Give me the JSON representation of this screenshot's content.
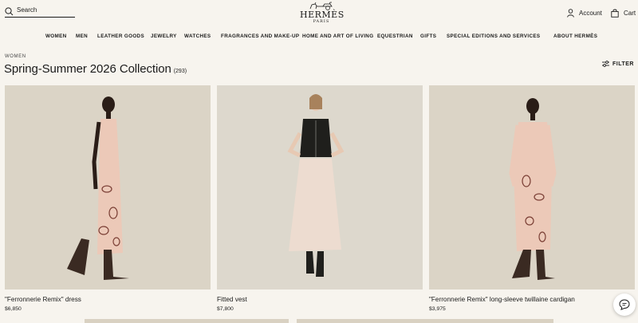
{
  "header": {
    "search_placeholder": "Search",
    "logo_brand": "HERMÈS",
    "logo_city": "PARIS",
    "account_label": "Account",
    "cart_label": "Cart"
  },
  "nav": {
    "items": [
      "WOMEN",
      "MEN",
      "LEATHER GOODS",
      "JEWELRY",
      "WATCHES",
      "FRAGRANCES AND MAKE-UP",
      "HOME AND ART OF LIVING",
      "EQUESTRIAN",
      "GIFTS",
      "SPECIAL EDITIONS AND SERVICES",
      "ABOUT HERMÈS"
    ]
  },
  "page": {
    "breadcrumb": "WOMEN",
    "title": "Spring-Summer 2026 Collection",
    "count": "(293)",
    "filter_label": "FILTER"
  },
  "products": [
    {
      "name": "\"Ferronnerie Remix\" dress",
      "price": "$6,850"
    },
    {
      "name": "Fitted vest",
      "price": "$7,800"
    },
    {
      "name": "\"Ferronnerie Remix\" long-sleeve twillaine cardigan",
      "price": "$3,975"
    }
  ],
  "icons": {
    "search": "search-icon",
    "account": "user-icon",
    "cart": "shopping-bag-icon",
    "filter": "sliders-icon",
    "chat": "chat-bubble-icon"
  },
  "colors": {
    "background": "#f7f4ee",
    "text": "#1b1b1b",
    "image_backdrop": "#dbd4c6"
  }
}
